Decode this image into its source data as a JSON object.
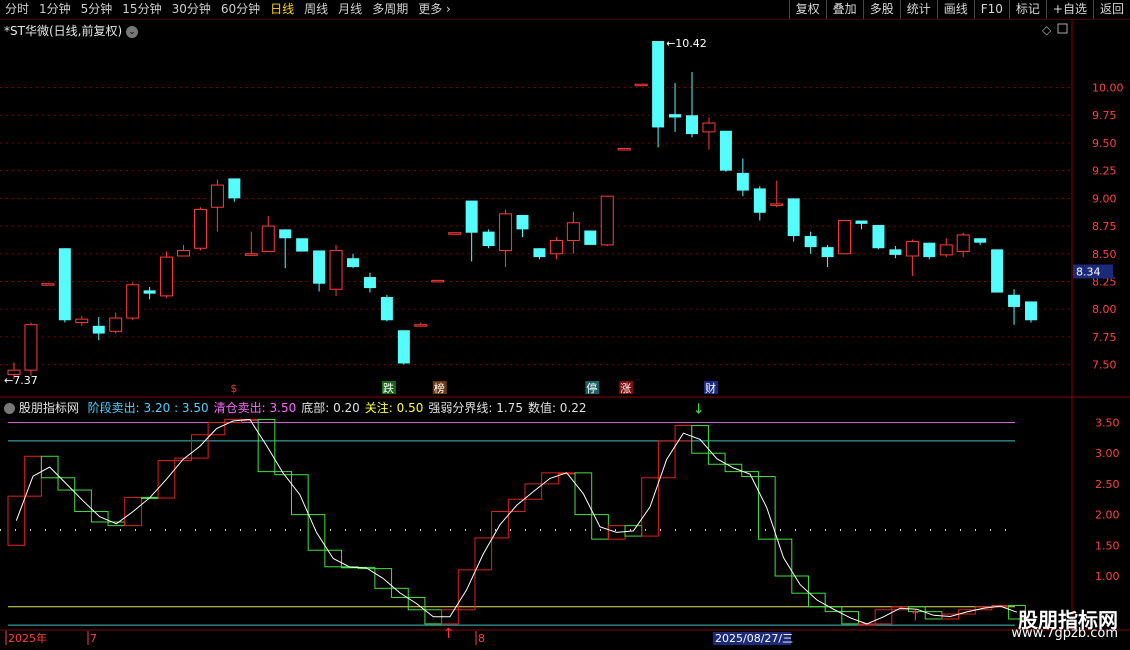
{
  "toolbar": {
    "periods": [
      "分时",
      "1分钟",
      "5分钟",
      "15分钟",
      "30分钟",
      "60分钟",
      "日线",
      "周线",
      "月线",
      "多周期",
      "更多"
    ],
    "active_period": "日线",
    "more_arrow": "›",
    "right_buttons": [
      "复权",
      "叠加",
      "多股",
      "统计",
      "画线",
      "F10",
      "标记",
      "+自选",
      "返回"
    ]
  },
  "main_panel": {
    "title": "*ST华微(日线,前复权)",
    "title_arrow": "⌄",
    "high_label": "10.42",
    "low_label": "7.37",
    "price_ticks": [
      "10.00",
      "9.75",
      "9.50",
      "9.25",
      "9.00",
      "8.75",
      "8.50",
      "8.25",
      "8.00",
      "7.75",
      "7.50"
    ],
    "current_price": "8.34",
    "event_markers": [
      {
        "text": "$",
        "color": "#ff3030"
      },
      {
        "text": "跌",
        "color": "#ffffff",
        "bg": "#1a6a1a"
      },
      {
        "text": "榜",
        "color": "#ffffff",
        "bg": "#6a3a10"
      },
      {
        "text": "停",
        "color": "#ffffff",
        "bg": "#1a6060"
      },
      {
        "text": "涨",
        "color": "#ffffff",
        "bg": "#801010"
      },
      {
        "text": "财",
        "color": "#ffffff",
        "bg": "#1a2a80"
      }
    ]
  },
  "indicator_panel": {
    "name": "股朋指标网",
    "items": [
      {
        "label": "阶段卖出: 3.20 : 3.50",
        "color": "#4fd2ff"
      },
      {
        "label": "清仓卖出: 3.50",
        "color": "#ff66ff"
      },
      {
        "label": "底部: 0.20",
        "color": "#e0e0e0"
      },
      {
        "label": "关注: 0.50",
        "color": "#ffff40"
      },
      {
        "label": "强弱分界线: 1.75",
        "color": "#e0e0e0"
      },
      {
        "label": "数值: 0.22",
        "color": "#e0e0e0"
      }
    ],
    "ticks": [
      "3.50",
      "3.00",
      "2.50",
      "2.00",
      "1.50",
      "1.00"
    ]
  },
  "date_axis": {
    "labels": [
      "2025年",
      "7",
      "8"
    ],
    "cursor_date": "2025/08/27/三"
  },
  "watermark": {
    "line1": "股朋指标网",
    "line2": "www.7gpzb.com"
  },
  "colors": {
    "up": "#ff3b3b",
    "down": "#54fcfc",
    "ind_up": "#e02020",
    "ind_down": "#40e040",
    "ma": "#ffffff",
    "grid": "#8a0000"
  },
  "chart_data": [
    {
      "type": "candlestick",
      "title": "*ST华微(日线,前复权)",
      "ylim": [
        7.37,
        10.42
      ],
      "ohlc": [
        [
          7.41,
          7.52,
          7.37,
          7.45
        ],
        [
          7.45,
          7.88,
          7.4,
          7.86
        ],
        [
          8.23,
          8.23,
          8.23,
          8.23
        ],
        [
          8.55,
          8.55,
          7.88,
          7.9
        ],
        [
          7.88,
          7.94,
          7.85,
          7.91
        ],
        [
          7.85,
          7.93,
          7.72,
          7.78
        ],
        [
          7.8,
          7.97,
          7.78,
          7.92
        ],
        [
          7.92,
          8.24,
          7.9,
          8.22
        ],
        [
          8.17,
          8.2,
          8.09,
          8.14
        ],
        [
          8.12,
          8.52,
          8.1,
          8.47
        ],
        [
          8.48,
          8.58,
          8.48,
          8.53
        ],
        [
          8.55,
          8.92,
          8.53,
          8.9
        ],
        [
          8.92,
          9.17,
          8.7,
          9.12
        ],
        [
          9.18,
          9.18,
          8.97,
          9.0
        ],
        [
          8.5,
          8.7,
          8.5,
          8.5
        ],
        [
          8.52,
          8.84,
          8.52,
          8.75
        ],
        [
          8.72,
          8.72,
          8.37,
          8.64
        ],
        [
          8.64,
          8.64,
          8.52,
          8.52
        ],
        [
          8.53,
          8.53,
          8.16,
          8.23
        ],
        [
          8.18,
          8.58,
          8.12,
          8.53
        ],
        [
          8.46,
          8.5,
          8.37,
          8.38
        ],
        [
          8.29,
          8.33,
          8.15,
          8.19
        ],
        [
          8.11,
          8.13,
          7.89,
          7.9
        ],
        [
          7.81,
          7.81,
          7.5,
          7.51
        ],
        [
          7.85,
          7.88,
          7.85,
          7.86
        ],
        [
          8.26,
          8.26,
          8.26,
          8.26
        ],
        [
          8.69,
          8.69,
          8.69,
          8.69
        ],
        [
          8.98,
          8.98,
          8.43,
          8.69
        ],
        [
          8.7,
          8.72,
          8.55,
          8.57
        ],
        [
          8.53,
          8.9,
          8.38,
          8.86
        ],
        [
          8.85,
          8.85,
          8.65,
          8.72
        ],
        [
          8.55,
          8.55,
          8.45,
          8.47
        ],
        [
          8.5,
          8.65,
          8.45,
          8.62
        ],
        [
          8.62,
          8.88,
          8.5,
          8.78
        ],
        [
          8.71,
          8.71,
          8.58,
          8.58
        ],
        [
          8.58,
          9.02,
          8.57,
          9.02
        ],
        [
          9.45,
          9.45,
          9.45,
          9.45
        ],
        [
          10.03,
          10.03,
          10.03,
          10.03
        ],
        [
          10.42,
          10.42,
          9.46,
          9.64
        ],
        [
          9.76,
          10.04,
          9.6,
          9.73
        ],
        [
          9.75,
          10.14,
          9.55,
          9.58
        ],
        [
          9.6,
          9.73,
          9.44,
          9.68
        ],
        [
          9.61,
          9.61,
          9.24,
          9.25
        ],
        [
          9.23,
          9.36,
          9.02,
          9.07
        ],
        [
          9.09,
          9.11,
          8.8,
          8.87
        ],
        [
          8.94,
          9.16,
          8.92,
          8.95
        ],
        [
          9.0,
          9.0,
          8.61,
          8.66
        ],
        [
          8.66,
          8.7,
          8.5,
          8.56
        ],
        [
          8.56,
          8.58,
          8.38,
          8.47
        ],
        [
          8.5,
          8.8,
          8.5,
          8.8
        ],
        [
          8.8,
          8.8,
          8.72,
          8.77
        ],
        [
          8.76,
          8.76,
          8.54,
          8.55
        ],
        [
          8.54,
          8.57,
          8.46,
          8.49
        ],
        [
          8.48,
          8.63,
          8.3,
          8.61
        ],
        [
          8.6,
          8.6,
          8.45,
          8.47
        ],
        [
          8.49,
          8.64,
          8.47,
          8.58
        ],
        [
          8.52,
          8.69,
          8.47,
          8.67
        ],
        [
          8.64,
          8.64,
          8.58,
          8.6
        ],
        [
          8.54,
          8.54,
          8.15,
          8.15
        ],
        [
          8.13,
          8.18,
          7.86,
          8.02
        ],
        [
          8.07,
          8.07,
          7.88,
          7.9
        ]
      ]
    },
    {
      "type": "step-bar",
      "name": "股朋指标网",
      "ylim": [
        0,
        3.6
      ],
      "reference_lines": [
        3.5,
        3.2,
        1.75,
        0.5,
        0.2
      ],
      "values": [
        1.5,
        2.3,
        2.95,
        2.6,
        2.4,
        2.05,
        1.88,
        1.82,
        2.28,
        2.27,
        2.88,
        2.92,
        3.3,
        3.5,
        3.55,
        3.55,
        2.7,
        2.65,
        2.0,
        1.42,
        1.15,
        1.14,
        1.12,
        0.8,
        0.65,
        0.45,
        0.22,
        0.45,
        1.1,
        1.62,
        2.05,
        2.25,
        2.5,
        2.68,
        2.68,
        2.0,
        1.6,
        1.82,
        1.65,
        2.6,
        3.2,
        3.45,
        3.0,
        2.82,
        2.7,
        2.62,
        1.6,
        1.0,
        0.72,
        0.5,
        0.42,
        0.22,
        0.22,
        0.45,
        0.5,
        0.42,
        0.3,
        0.38,
        0.45,
        0.5,
        0.52,
        0.3
      ],
      "arrows": [
        {
          "index": 26,
          "dir": "up"
        },
        {
          "index": 41,
          "dir": "down"
        },
        {
          "index": 54,
          "dir": "up"
        }
      ]
    }
  ]
}
